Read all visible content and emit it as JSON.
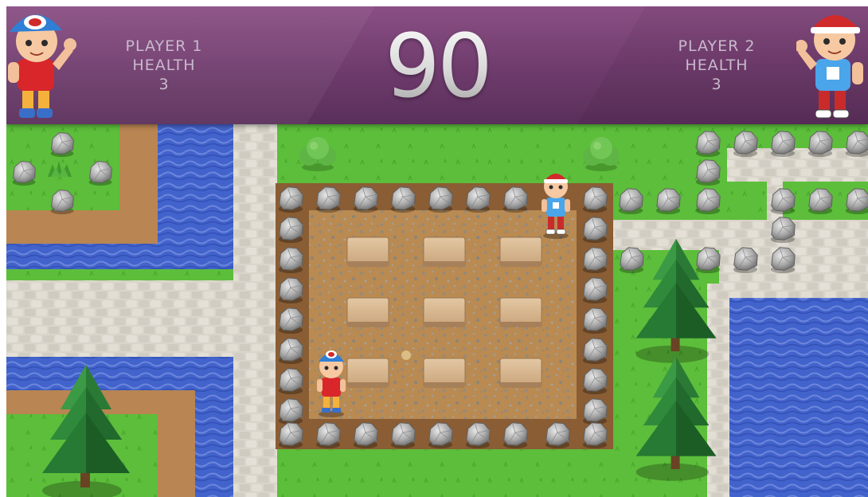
{
  "hud": {
    "player1": {
      "name": "PLAYER 1",
      "label": "HEALTH",
      "value": "3"
    },
    "player2": {
      "name": "PLAYER 2",
      "label": "HEALTH",
      "value": "3"
    },
    "timer": "90"
  },
  "colors": {
    "hud_purple": "#7a4576",
    "grass": "#5fbf3d",
    "water": "#3f5bc7",
    "path": "#d8d4c9",
    "dirt_arena": "#b9894f",
    "player1_cap": "#2f7fd6",
    "player2_cap": "#d02a2a"
  },
  "scene": {
    "arena_grid": {
      "columns": 3,
      "rows": 3
    },
    "boulder_icon": "rock-boulder-icon",
    "tree_icon": "pine-tree-icon",
    "bush_icon": "bush-icon"
  }
}
